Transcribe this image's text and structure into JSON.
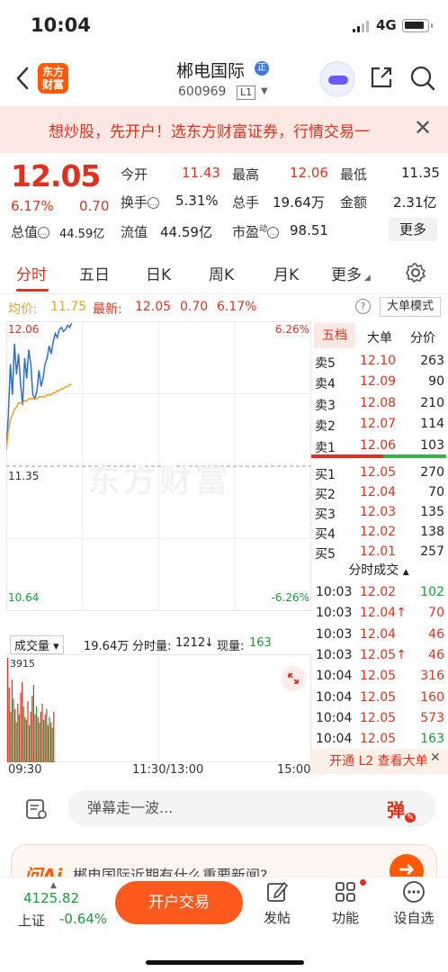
{
  "status": {
    "time": "10:04",
    "network": "4G"
  },
  "header": {
    "back_icon": "chevron-left-icon",
    "logo_text": "东方\n财富",
    "stock_name": "郴电国际",
    "stock_code": "600969",
    "level": "L1",
    "verified_badge": "正"
  },
  "promo": {
    "text": "想炒股，先开户！选东方财富证券，行情交易一"
  },
  "quote": {
    "price": "12.05",
    "change_pct": "6.17%",
    "change": "0.70",
    "rows": [
      [
        {
          "label": "今开",
          "value": "11.43",
          "color": "red"
        },
        {
          "label": "最高",
          "value": "12.06",
          "color": "red"
        },
        {
          "label": "最低",
          "value": "11.35",
          "color": "black"
        }
      ],
      [
        {
          "label": "换手",
          "value": "5.31%",
          "color": "black"
        },
        {
          "label": "总手",
          "value": "19.64万",
          "color": "black"
        },
        {
          "label": "金额",
          "value": "2.31亿",
          "color": "black"
        }
      ],
      [
        {
          "label": "总值",
          "value": "44.59亿",
          "color": "black"
        },
        {
          "label": "流值",
          "value": "44.59亿",
          "color": "black"
        },
        {
          "label": "市盈",
          "sup": "动",
          "value": "98.51",
          "color": "black"
        }
      ]
    ],
    "more_label": "更多"
  },
  "tabs": {
    "items": [
      "分时",
      "五日",
      "日K",
      "周K",
      "月K",
      "更多"
    ],
    "active": 0
  },
  "avg_line": {
    "avg_label": "均价:",
    "avg_value": "11.75",
    "latest_label": "最新:",
    "latest_value": "12.05",
    "latest_chg": "0.70",
    "latest_pct": "6.17%",
    "big_order_mode": "大单模式"
  },
  "chart_labels": {
    "top_left": "12.06",
    "top_right": "6.26%",
    "mid_left": "11.35",
    "bottom_left": "10.64",
    "bottom_right": "-6.26%",
    "watermark": "东方财富"
  },
  "chart_data": {
    "type": "line",
    "title": "",
    "y_price_range": [
      10.64,
      12.06
    ],
    "y_pct_range": [
      -6.26,
      6.26
    ],
    "prev_close": 11.35,
    "series": [
      {
        "name": "",
        "values": [
          11.43,
          11.6,
          11.85,
          11.7,
          11.95,
          11.8,
          11.9,
          11.75,
          11.65,
          11.88,
          11.78,
          11.92,
          11.85,
          11.7,
          11.68,
          11.72,
          11.82,
          11.74,
          11.78,
          11.85,
          11.88,
          11.94,
          11.9,
          11.96,
          12.0,
          11.98,
          12.02,
          12.03,
          12.01,
          12.02,
          12.04,
          12.03,
          12.05
        ]
      },
      {
        "name": "",
        "values": [
          11.43,
          11.52,
          11.58,
          11.6,
          11.63,
          11.64,
          11.66,
          11.66,
          11.66,
          11.67,
          11.67,
          11.68,
          11.68,
          11.68,
          11.68,
          11.68,
          11.69,
          11.69,
          11.69,
          11.69,
          11.7,
          11.7,
          11.7,
          11.71,
          11.71,
          11.72,
          11.72,
          11.73,
          11.73,
          11.74,
          11.74,
          11.75,
          11.75
        ]
      }
    ],
    "volume": [
      3915,
      2800,
      1900,
      3100,
      2400,
      2000,
      1500,
      2200,
      1800,
      2600,
      3000,
      2100,
      1700,
      1600,
      2300,
      1400,
      1900,
      2500,
      2900,
      1800,
      2100,
      1700,
      1500,
      1900,
      2200,
      1600,
      1800,
      2000,
      1400,
      1700,
      1500,
      1300,
      1900
    ],
    "volume_up": [
      true,
      true,
      false,
      true,
      false,
      true,
      false,
      true,
      false,
      true,
      true,
      false,
      true,
      false,
      true,
      false,
      true,
      true,
      false,
      true,
      false,
      true,
      false,
      true,
      true,
      false,
      true,
      false,
      true,
      false,
      true,
      false,
      true
    ],
    "volume_max_label": "3915",
    "x_ticks": [
      "09:30",
      "11:30/13:00",
      "15:00"
    ]
  },
  "volume_head": {
    "label": "成交量",
    "total": "19.64万",
    "tick_label": "分时量:",
    "tick_value": "1212",
    "now_label": "现量:",
    "now_value": "163"
  },
  "order_book": {
    "tabs": [
      "五档",
      "大单",
      "分价"
    ],
    "asks": [
      {
        "label": "卖5",
        "price": "12.10",
        "vol": "263"
      },
      {
        "label": "卖4",
        "price": "12.09",
        "vol": "90"
      },
      {
        "label": "卖3",
        "price": "12.08",
        "vol": "210"
      },
      {
        "label": "卖2",
        "price": "12.07",
        "vol": "114"
      },
      {
        "label": "卖1",
        "price": "12.06",
        "vol": "103"
      }
    ],
    "bids": [
      {
        "label": "买1",
        "price": "12.05",
        "vol": "270"
      },
      {
        "label": "买2",
        "price": "12.04",
        "vol": "70"
      },
      {
        "label": "买3",
        "price": "12.03",
        "vol": "135"
      },
      {
        "label": "买4",
        "price": "12.02",
        "vol": "138"
      },
      {
        "label": "买5",
        "price": "12.01",
        "vol": "257"
      }
    ],
    "trades_title": "分时成交",
    "trades": [
      {
        "time": "10:03",
        "price": "12.02",
        "vol": "102",
        "vol_color": "green"
      },
      {
        "time": "10:03",
        "price": "12.04↑",
        "vol": "70",
        "vol_color": "red"
      },
      {
        "time": "10:03",
        "price": "12.04",
        "vol": "46",
        "vol_color": "red"
      },
      {
        "time": "10:03",
        "price": "12.05↑",
        "vol": "46",
        "vol_color": "red"
      },
      {
        "time": "10:04",
        "price": "12.05",
        "vol": "316",
        "vol_color": "red"
      },
      {
        "time": "10:04",
        "price": "12.05",
        "vol": "160",
        "vol_color": "red"
      },
      {
        "time": "10:04",
        "price": "12.05",
        "vol": "573",
        "vol_color": "red"
      },
      {
        "time": "10:04",
        "price": "12.05",
        "vol": "163",
        "vol_color": "green"
      }
    ],
    "l2_label": "开通 L2 查看大单"
  },
  "danmu": {
    "placeholder": "弹幕走一波...",
    "button": "弹"
  },
  "ai": {
    "logo": "问Ai",
    "text": "郴电国际近期有什么重要新闻?"
  },
  "bottom": {
    "index_value": "4125.82",
    "index_name": "上证",
    "index_chg": "-0.64%",
    "trade_button": "开户交易",
    "items": [
      "发帖",
      "功能",
      "设自选"
    ]
  },
  "colors": {
    "up": "#e0301e",
    "down": "#1a9a3a",
    "brand": "#ff5a00",
    "price_line": "#2e6fd0",
    "avg_line": "#f0a020"
  }
}
